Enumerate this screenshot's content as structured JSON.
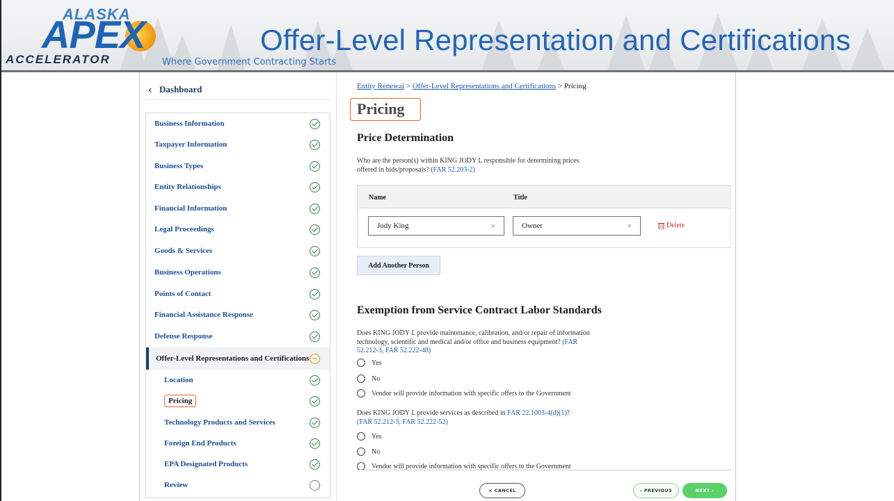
{
  "header": {
    "logo": {
      "alaska": "ALASKA",
      "apex": "APEX",
      "accelerator": "ACCELERATOR"
    },
    "tagline": "Where Government Contracting Starts",
    "title": "Offer-Level Representation and Certifications"
  },
  "sidebar": {
    "dashboard_label": "Dashboard",
    "items": [
      {
        "label": "Business Information",
        "status": "complete"
      },
      {
        "label": "Taxpayer Information",
        "status": "complete"
      },
      {
        "label": "Business Types",
        "status": "complete"
      },
      {
        "label": "Entity Relationships",
        "status": "complete"
      },
      {
        "label": "Financial Information",
        "status": "complete"
      },
      {
        "label": "Legal Proceedings",
        "status": "complete"
      },
      {
        "label": "Goods & Services",
        "status": "complete"
      },
      {
        "label": "Business Operations",
        "status": "complete"
      },
      {
        "label": "Points of Contact",
        "status": "complete"
      },
      {
        "label": "Financial Assistance Response",
        "status": "complete"
      },
      {
        "label": "Defense Response",
        "status": "complete"
      },
      {
        "label": "Offer-Level Representations and Certifications",
        "status": "in-progress"
      },
      {
        "label": "Location",
        "status": "complete"
      },
      {
        "label": "Pricing",
        "status": "complete"
      },
      {
        "label": "Technology Products and Services",
        "status": "complete"
      },
      {
        "label": "Foreign End Products",
        "status": "complete"
      },
      {
        "label": "EPA Designated Products",
        "status": "complete"
      },
      {
        "label": "Review",
        "status": "not-started"
      }
    ]
  },
  "breadcrumb": {
    "link1": "Entity Renewal",
    "sep": ">",
    "link2": "Offer-Level Representations and Certifications",
    "current": "Pricing"
  },
  "main": {
    "page_title": "Pricing",
    "price_section": {
      "heading": "Price Determination",
      "question_text": "Who are the person(s) within KING JODY L responsible for determining prices offered in bids/proposals?",
      "question_ref": "(FAR 52.203-2)",
      "table_headers": [
        "Name",
        "Title"
      ],
      "rows": [
        {
          "name": "Jody King",
          "title": "Owner"
        }
      ],
      "clear_glyph": "×",
      "delete_label": "Delete",
      "add_button": "Add Another Person"
    },
    "exemption_section": {
      "heading": "Exemption from Service Contract Labor Standards",
      "q1_text": "Does KING JODY L provide maintenance, calibration, and/or repair of information technology, scientific and medical and/or office and business equipment?",
      "q1_refs": "(FAR 52.212-3, FAR 52.222-48)",
      "q2_text_a": "Does KING JODY L provide services as described in",
      "q2_link": "FAR 22.1003-4(d)(1)",
      "q2_text_b": "?",
      "q2_refs": "(FAR 52.212-3, FAR 52.222-52)",
      "options": [
        "Yes",
        "No",
        "Vendor will provide information with specific offers to the Government"
      ]
    },
    "footer": {
      "cancel": "× CANCEL",
      "previous": "‹ PREVIOUS",
      "next": "NEXT ›"
    }
  }
}
